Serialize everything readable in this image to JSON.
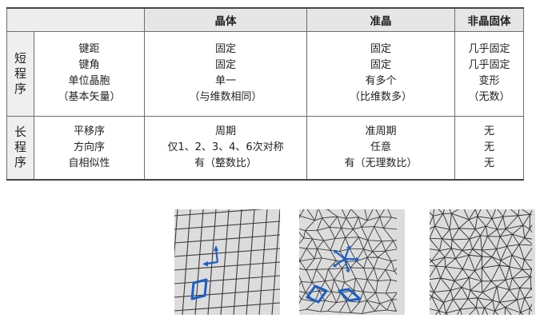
{
  "table": {
    "headers": [
      "",
      "晶体",
      "准晶",
      "非晶固体"
    ],
    "rows": [
      {
        "label": [
          "短",
          "程",
          "序"
        ],
        "cells": [
          [
            "键距",
            "键角",
            "单位晶胞",
            "（基本矢量）"
          ],
          [
            "固定",
            "固定",
            "单一",
            "（与维数相同）"
          ],
          [
            "固定",
            "固定",
            "有多个",
            "（比维数多）"
          ],
          [
            "几乎固定",
            "几乎固定",
            "变形",
            "（无数）"
          ]
        ]
      },
      {
        "label": [
          "长",
          "程",
          "序"
        ],
        "cells": [
          [
            "平移序",
            "方向序",
            "自相似性"
          ],
          [
            "周期",
            "仅1、2、3、4、6次对称",
            "有（整数比）"
          ],
          [
            "准周期",
            "任意",
            "有（无理数比）"
          ],
          [
            "无",
            "无",
            "无"
          ]
        ]
      }
    ]
  },
  "figures": {
    "accent": "#1b5fc4",
    "line_color": "#3a3a3a",
    "background": "#dcdcdc",
    "items": [
      {
        "name": "crystal-lattice",
        "icon": "square-grid-with-vectors"
      },
      {
        "name": "quasicrystal-tiling",
        "icon": "penrose-tiling-with-star"
      },
      {
        "name": "amorphous-network",
        "icon": "random-triangle-network"
      }
    ]
  }
}
